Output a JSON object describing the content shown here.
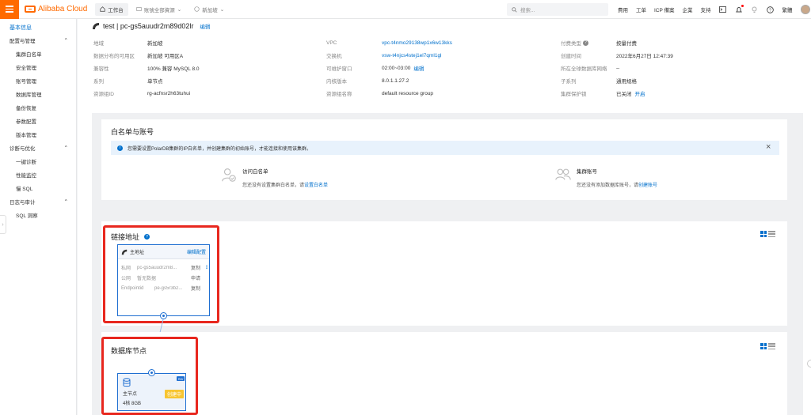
{
  "topbar": {
    "brand": "Alibaba Cloud",
    "nav": [
      {
        "label": "工作台",
        "icon": "home-icon"
      },
      {
        "label": "账號全部資源",
        "icon": "folder-icon"
      },
      {
        "label": "新加坡",
        "icon": "globe-icon"
      }
    ],
    "search_placeholder": "搜索...",
    "links": [
      "費用",
      "工单",
      "ICP 備案",
      "企業",
      "支持"
    ],
    "lang": "繁體"
  },
  "sidebar": {
    "top": "基本信息",
    "groups": [
      {
        "label": "配置与管理",
        "items": [
          "集群白名单",
          "安全管理",
          "账号管理",
          "数据库管理",
          "备份恢复",
          "参数配置",
          "版本管理"
        ]
      },
      {
        "label": "诊断与优化",
        "items": [
          "一键诊断",
          "性能监控",
          "慢 SQL"
        ]
      },
      {
        "label": "日志与审计",
        "items": [
          "SQL 洞察"
        ]
      }
    ]
  },
  "header": {
    "title": "test | pc-gs5auudr2m89d02lr",
    "edit": "编辑"
  },
  "info": {
    "rows": [
      [
        {
          "label": "地域",
          "value": "新加坡"
        },
        {
          "label": "VPC",
          "value": "vpc-t4nmo29138wp1x6w13kks",
          "link": true
        },
        {
          "label": "付费类型",
          "value": "按量付费",
          "help": true
        }
      ],
      [
        {
          "label": "数据分布的可用区",
          "value": "新加坡 可用区A"
        },
        {
          "label": "交换机",
          "value": "vsw-t4njcs4stej1el7qml1gl",
          "link": true
        },
        {
          "label": "创建时间",
          "value": "2022年6月27日 12:47:39"
        }
      ],
      [
        {
          "label": "兼容性",
          "value": "100% 兼容 MySQL 8.0"
        },
        {
          "label": "可维护窗口",
          "value": "02:00~03:00",
          "action": "编辑"
        },
        {
          "label": "所在全球数据库网络",
          "value": "--"
        }
      ],
      [
        {
          "label": "系列",
          "value": "单节点"
        },
        {
          "label": "内核版本",
          "value": "8.0.1.1.27.2"
        },
        {
          "label": "子系列",
          "value": "通用规格"
        }
      ],
      [
        {
          "label": "资源组ID",
          "value": "rg-acfnsr2h63tuhui"
        },
        {
          "label": "资源组名称",
          "value": "default resource group"
        },
        {
          "label": "集群保护锁",
          "value": "已关闭",
          "action": "开启"
        }
      ]
    ]
  },
  "whitelist": {
    "title": "白名单与账号",
    "notice": "您需要设置PolarDB集群的IP白名单，并创建集群的初始账号，才能连接和使用该集群。",
    "access": {
      "title": "访问白名单",
      "desc": "您还没有设置集群白名单，请",
      "link": "设置白名单"
    },
    "account": {
      "title": "集群账号",
      "desc": "您还没有添加数据库账号，请",
      "link": "创建账号"
    }
  },
  "endpoint": {
    "title": "链接地址",
    "card_title": "主地址",
    "card_action": "编辑配置",
    "rows": [
      {
        "k": "私网",
        "v": "pc-gs5auudr2m8...",
        "act": "复制"
      },
      {
        "k": "公网",
        "v": "暂无数据",
        "act": "申请"
      },
      {
        "k": "Endpointid",
        "v": "pe-gs5r3b2...",
        "act": "复制"
      }
    ]
  },
  "nodes": {
    "title": "数据库节点",
    "card": {
      "role": "主节点",
      "spec": "4核 8GB",
      "status": "创建中",
      "tag": "RW"
    }
  },
  "colors": {
    "accent": "#ff6a00",
    "link": "#0070cc",
    "highlight": "#e8271e",
    "status": "#f7c531"
  }
}
